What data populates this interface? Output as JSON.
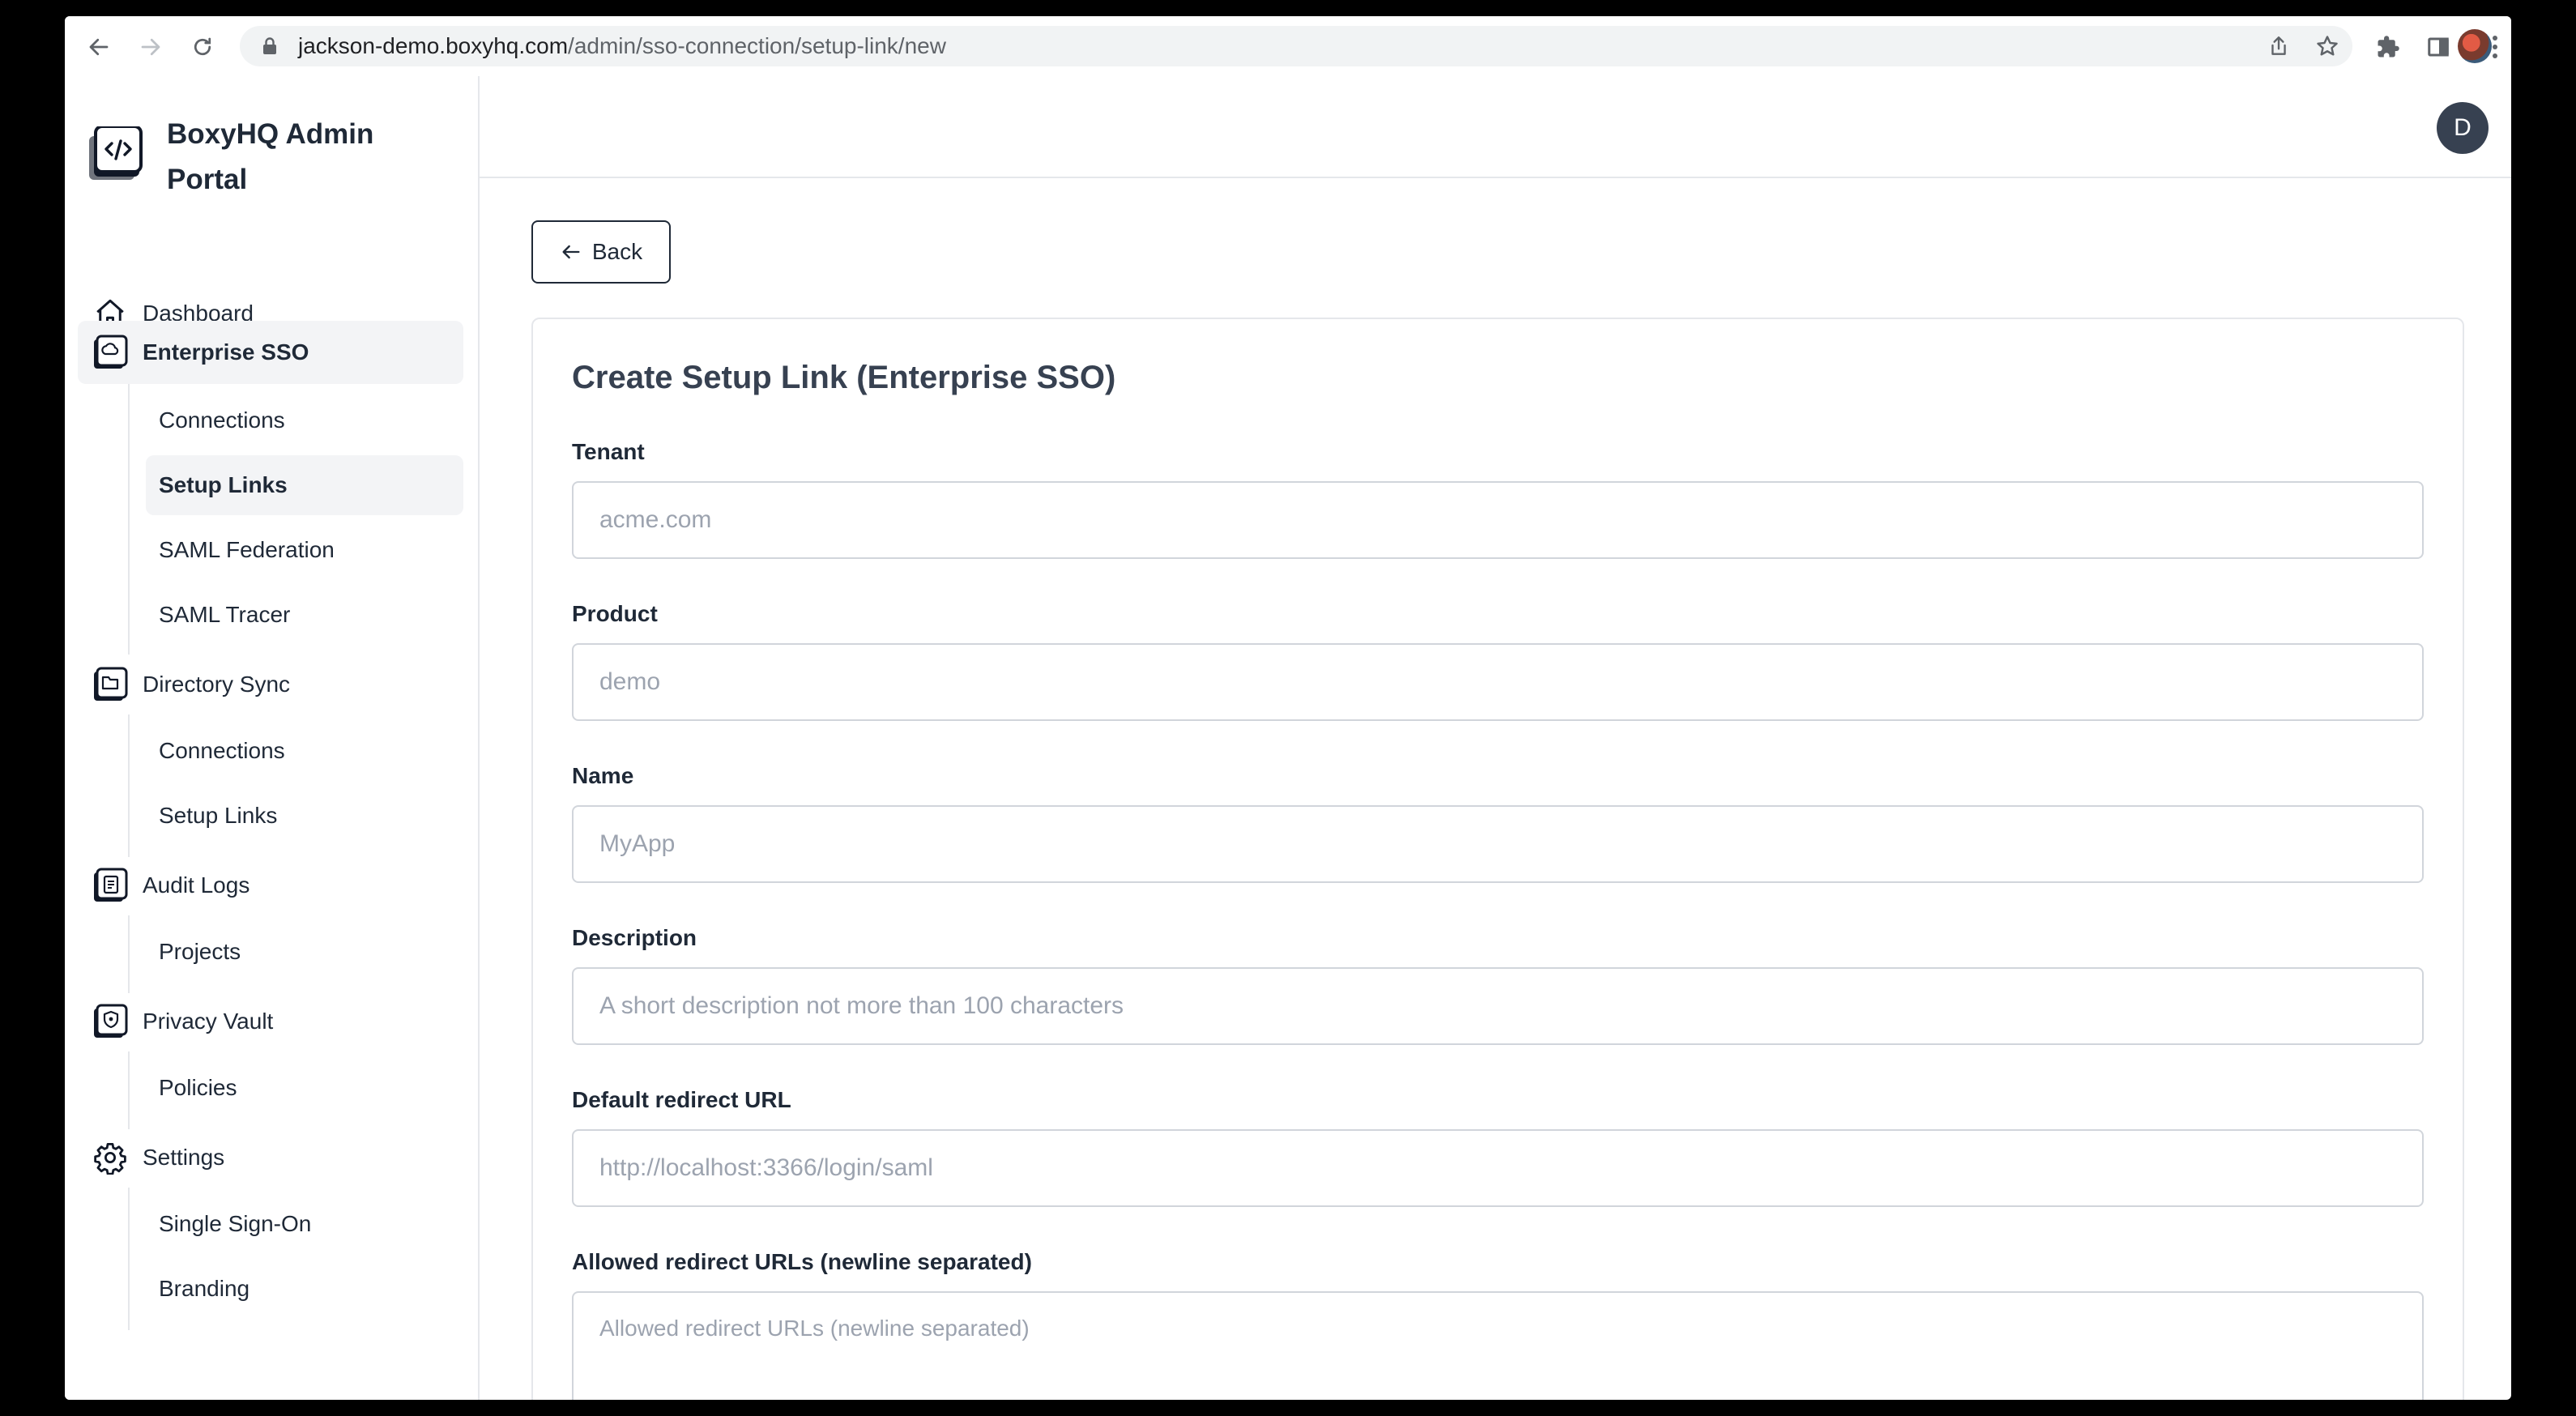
{
  "browser": {
    "url_host": "jackson-demo.boxyhq.com",
    "url_path": "/admin/sso-connection/setup-link/new"
  },
  "brand": {
    "title": "BoxyHQ Admin Portal"
  },
  "sidebar": {
    "items": [
      {
        "label": "Dashboard",
        "icon": "home-icon"
      },
      {
        "label": "Enterprise SSO",
        "icon": "enterprise-sso-icon",
        "active": true,
        "children": [
          {
            "label": "Connections"
          },
          {
            "label": "Setup Links",
            "active": true
          },
          {
            "label": "SAML Federation"
          },
          {
            "label": "SAML Tracer"
          }
        ]
      },
      {
        "label": "Directory Sync",
        "icon": "directory-sync-icon",
        "children": [
          {
            "label": "Connections"
          },
          {
            "label": "Setup Links"
          }
        ]
      },
      {
        "label": "Audit Logs",
        "icon": "audit-logs-icon",
        "children": [
          {
            "label": "Projects"
          }
        ]
      },
      {
        "label": "Privacy Vault",
        "icon": "privacy-vault-icon",
        "children": [
          {
            "label": "Policies"
          }
        ]
      },
      {
        "label": "Settings",
        "icon": "gear-icon",
        "children": [
          {
            "label": "Single Sign-On"
          },
          {
            "label": "Branding"
          }
        ]
      }
    ]
  },
  "header": {
    "avatar_initial": "D"
  },
  "main": {
    "back_label": "Back",
    "title": "Create Setup Link (Enterprise SSO)",
    "fields": [
      {
        "label": "Tenant",
        "value": "",
        "placeholder": "acme.com"
      },
      {
        "label": "Product",
        "value": "",
        "placeholder": "demo"
      },
      {
        "label": "Name",
        "value": "",
        "placeholder": "MyApp"
      },
      {
        "label": "Description",
        "value": "",
        "placeholder": "A short description not more than 100 characters"
      },
      {
        "label": "Default redirect URL",
        "value": "",
        "placeholder": "http://localhost:3366/login/saml"
      },
      {
        "label": "Allowed redirect URLs (newline separated)",
        "value": "",
        "placeholder": "Allowed redirect URLs (newline separated)"
      }
    ]
  },
  "colors": {
    "active_bg": "#f3f4f6",
    "border": "#e5e7eb",
    "avatar_bg": "#374151",
    "placeholder": "#9ca3af"
  }
}
